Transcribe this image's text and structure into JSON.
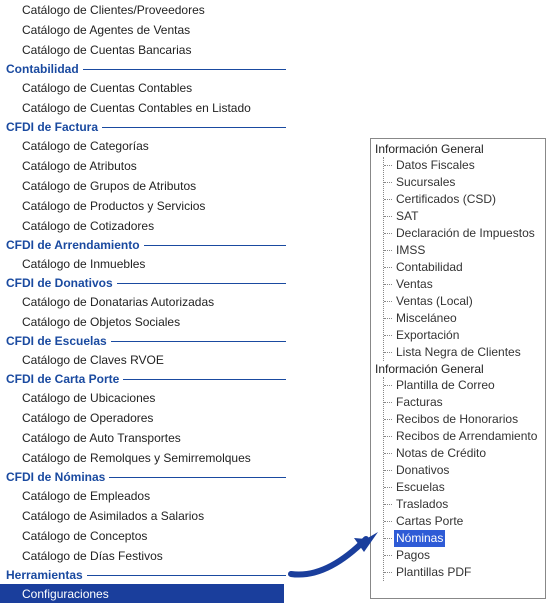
{
  "colors": {
    "category": "#1a4aa0",
    "selection_bg_left": "#1a3e9c",
    "selection_bg_right": "#2e5bd6"
  },
  "left_menu": {
    "pre_items": [
      "Catálogo de Clientes/Proveedores",
      "Catálogo de Agentes de Ventas",
      "Catálogo de Cuentas Bancarias"
    ],
    "sections": [
      {
        "title": "Contabilidad",
        "items": [
          "Catálogo de Cuentas Contables",
          "Catálogo de Cuentas Contables en Listado"
        ]
      },
      {
        "title": "CFDI de Factura",
        "items": [
          "Catálogo de Categorías",
          "Catálogo de Atributos",
          "Catálogo de Grupos de Atributos",
          "Catálogo de Productos y Servicios",
          "Catálogo de Cotizadores"
        ]
      },
      {
        "title": "CFDI de Arrendamiento",
        "items": [
          "Catálogo de Inmuebles"
        ]
      },
      {
        "title": "CFDI de Donativos",
        "items": [
          "Catálogo de Donatarias Autorizadas",
          "Catálogo de Objetos Sociales"
        ]
      },
      {
        "title": "CFDI de Escuelas",
        "items": [
          "Catálogo de Claves RVOE"
        ]
      },
      {
        "title": "CFDI de Carta Porte",
        "items": [
          "Catálogo de Ubicaciones",
          "Catálogo de Operadores",
          "Catálogo de Auto Transportes",
          "Catálogo de Remolques y Semirremolques"
        ]
      },
      {
        "title": "CFDI de Nóminas",
        "items": [
          "Catálogo de Empleados",
          "Catálogo de Asimilados a Salarios",
          "Catálogo de Conceptos",
          "Catálogo de Días Festivos"
        ]
      },
      {
        "title": "Herramientas",
        "items": [],
        "selected_item": "Configuraciones"
      }
    ]
  },
  "right_tree": {
    "groups": [
      {
        "label": "Información General",
        "children": [
          "Datos Fiscales",
          "Sucursales",
          "Certificados (CSD)",
          "SAT",
          "Declaración de Impuestos",
          "IMSS",
          "Contabilidad",
          "Ventas",
          "Ventas (Local)",
          "Misceláneo",
          "Exportación",
          "Lista Negra de Clientes"
        ]
      },
      {
        "label": "Información General",
        "children": [
          "Plantilla de Correo",
          "Facturas",
          "Recibos de Honorarios",
          "Recibos de Arrendamiento",
          "Notas de Crédito",
          "Donativos",
          "Escuelas",
          "Traslados",
          "Cartas Porte",
          {
            "label": "Nóminas",
            "selected": true
          },
          "Pagos",
          "Plantillas PDF"
        ]
      }
    ]
  }
}
